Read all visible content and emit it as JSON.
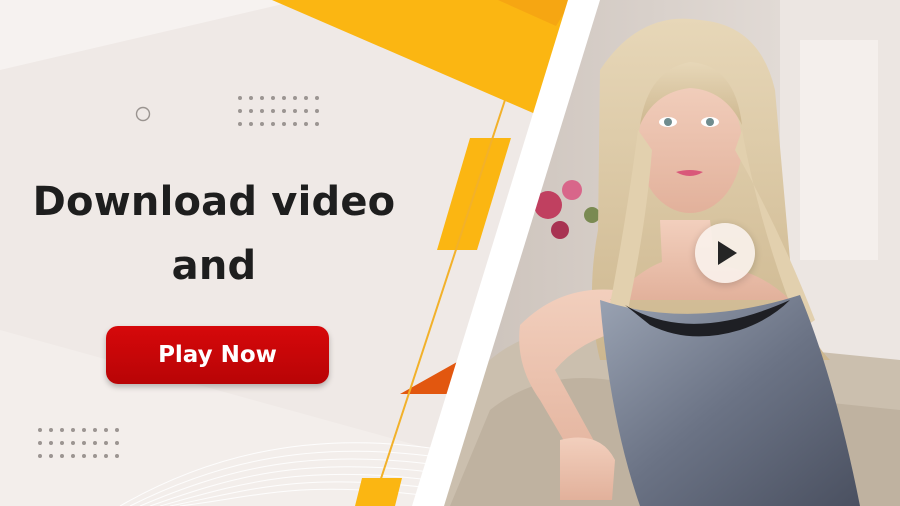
{
  "headline": {
    "line1": "Download video",
    "line2": "and"
  },
  "cta": {
    "label": "Play Now"
  },
  "video": {
    "control": "play-icon"
  },
  "colors": {
    "background": "#efe9e6",
    "accent_yellow": "#fbb612",
    "accent_orange": "#e2570f",
    "button_red": "#c80608",
    "text_dark": "#1e1e1e"
  }
}
